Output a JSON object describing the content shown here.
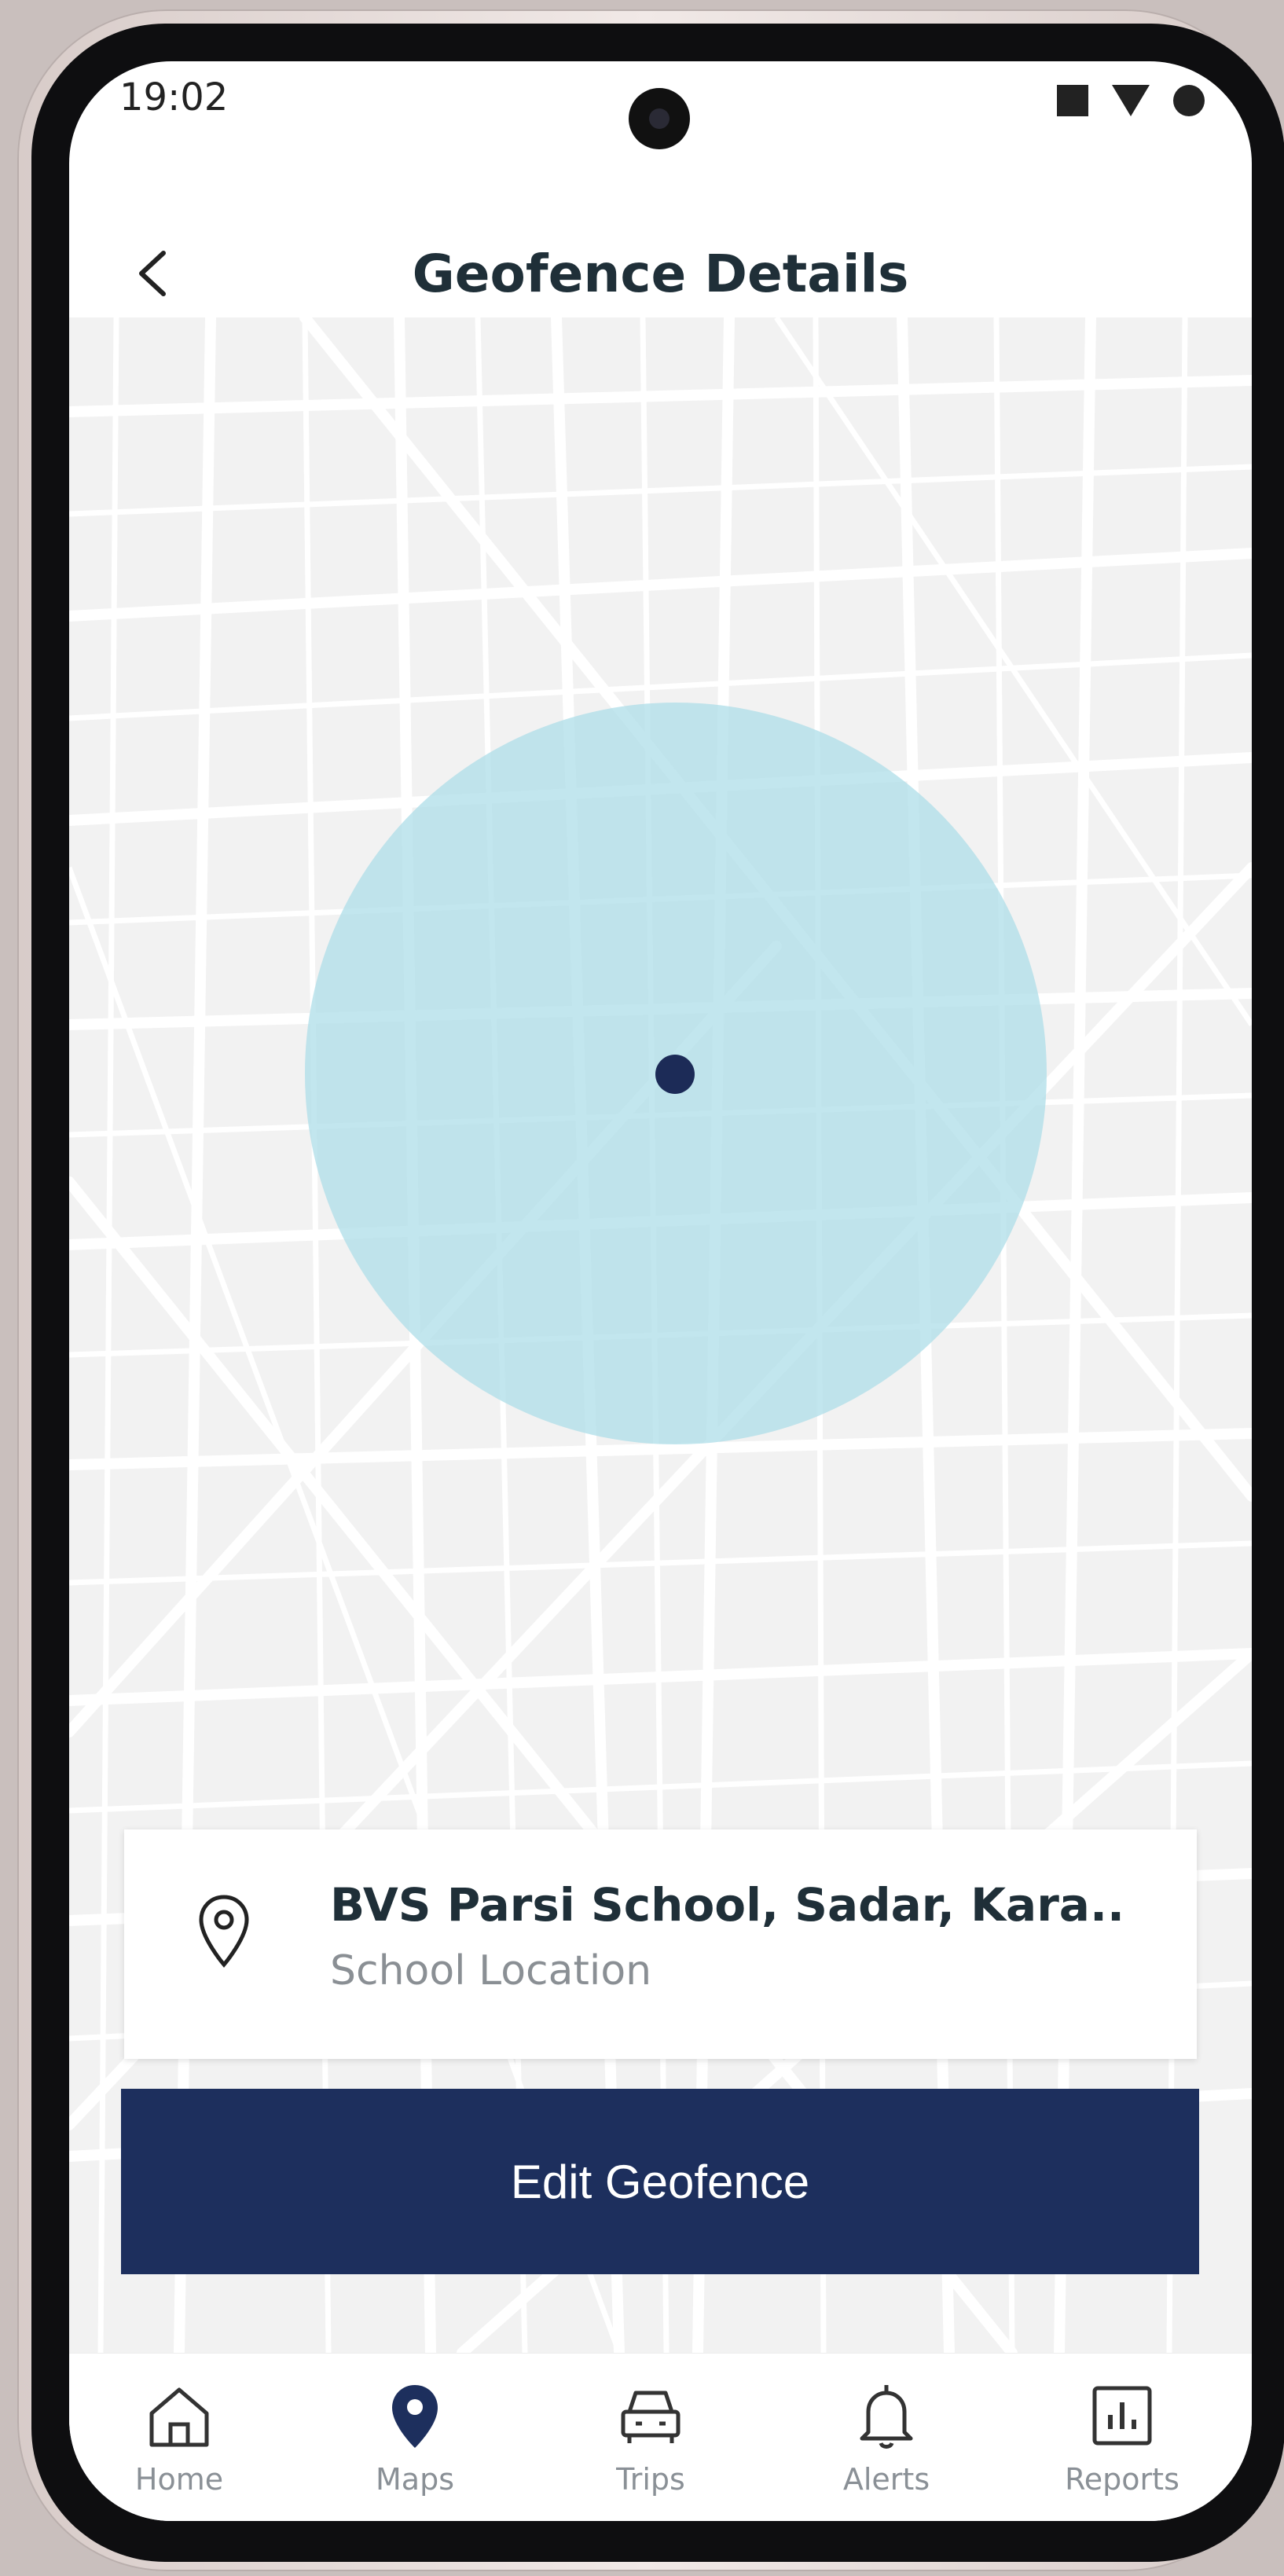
{
  "status_bar": {
    "time": "19:02"
  },
  "header": {
    "title": "Geofence Details",
    "back_icon": "chevron-left-icon"
  },
  "map": {
    "geofence_fill": "#addde8",
    "center_marker_color": "#1c2b57"
  },
  "location_card": {
    "icon": "location-pin-icon",
    "name": "BVS Parsi School, Sadar, Kara..",
    "subtitle": "School Location"
  },
  "actions": {
    "edit_label": "Edit Geofence",
    "button_color": "#1d2f5d"
  },
  "bottom_nav": {
    "items": [
      {
        "label": "Home",
        "icon": "home-icon"
      },
      {
        "label": "Maps",
        "icon": "map-pin-icon"
      },
      {
        "label": "Trips",
        "icon": "car-icon"
      },
      {
        "label": "Alerts",
        "icon": "bell-icon"
      },
      {
        "label": "Reports",
        "icon": "bar-chart-icon"
      }
    ],
    "active": "Maps"
  }
}
